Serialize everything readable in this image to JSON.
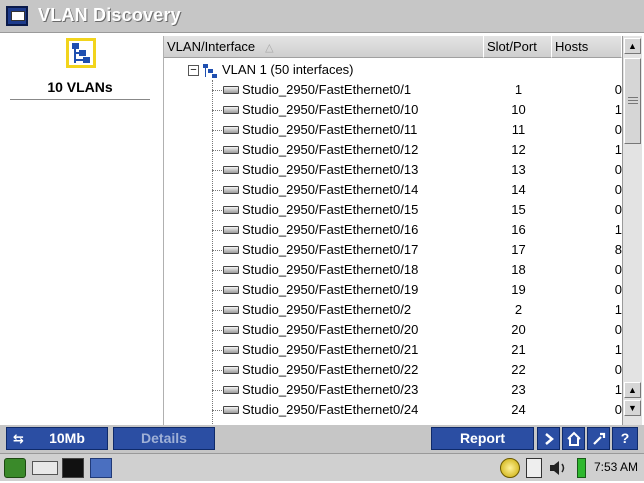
{
  "window": {
    "title": "VLAN Discovery"
  },
  "sidebar": {
    "summary_label": "10 VLANs"
  },
  "table": {
    "columns": [
      {
        "label": "VLAN/Interface",
        "sort_indicator": "△"
      },
      {
        "label": "Slot/Port"
      },
      {
        "label": "Hosts"
      }
    ],
    "group": {
      "expander": "−",
      "label": "VLAN 1 (50 interfaces)"
    },
    "rows": [
      {
        "name": "Studio_2950/FastEthernet0/1",
        "slot": "1",
        "hosts": "0"
      },
      {
        "name": "Studio_2950/FastEthernet0/10",
        "slot": "10",
        "hosts": "1"
      },
      {
        "name": "Studio_2950/FastEthernet0/11",
        "slot": "11",
        "hosts": "0"
      },
      {
        "name": "Studio_2950/FastEthernet0/12",
        "slot": "12",
        "hosts": "1"
      },
      {
        "name": "Studio_2950/FastEthernet0/13",
        "slot": "13",
        "hosts": "0"
      },
      {
        "name": "Studio_2950/FastEthernet0/14",
        "slot": "14",
        "hosts": "0"
      },
      {
        "name": "Studio_2950/FastEthernet0/15",
        "slot": "15",
        "hosts": "0"
      },
      {
        "name": "Studio_2950/FastEthernet0/16",
        "slot": "16",
        "hosts": "1"
      },
      {
        "name": "Studio_2950/FastEthernet0/17",
        "slot": "17",
        "hosts": "8"
      },
      {
        "name": "Studio_2950/FastEthernet0/18",
        "slot": "18",
        "hosts": "0"
      },
      {
        "name": "Studio_2950/FastEthernet0/19",
        "slot": "19",
        "hosts": "0"
      },
      {
        "name": "Studio_2950/FastEthernet0/2",
        "slot": "2",
        "hosts": "1"
      },
      {
        "name": "Studio_2950/FastEthernet0/20",
        "slot": "20",
        "hosts": "0"
      },
      {
        "name": "Studio_2950/FastEthernet0/21",
        "slot": "21",
        "hosts": "1"
      },
      {
        "name": "Studio_2950/FastEthernet0/22",
        "slot": "22",
        "hosts": "0"
      },
      {
        "name": "Studio_2950/FastEthernet0/23",
        "slot": "23",
        "hosts": "1"
      },
      {
        "name": "Studio_2950/FastEthernet0/24",
        "slot": "24",
        "hosts": "0"
      }
    ]
  },
  "scrollbar": {
    "up_arrow": "▲",
    "down_arrow": "▼"
  },
  "actionbar": {
    "speed_label": "10Mb",
    "details_label": "Details",
    "report_label": "Report",
    "back_icon": "back-arrow-icon",
    "home_icon": "home-icon",
    "tools_icon": "wrench-icon",
    "help_label": "?"
  },
  "taskbar": {
    "clock": "7:53 AM"
  },
  "colors": {
    "accent": "#2b4ea3",
    "chrome": "#c6c6c6",
    "icon_highlight": "#f2d41c"
  }
}
